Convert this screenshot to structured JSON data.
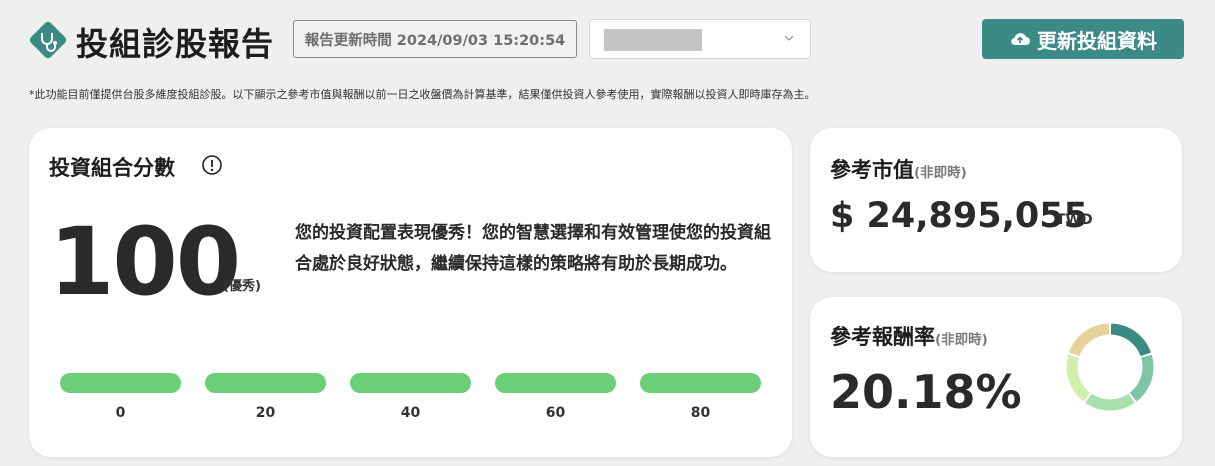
{
  "header": {
    "title": "投組診股報告",
    "update_time": "報告更新時間 2024/09/03 15:20:54",
    "update_button": "更新投組資料"
  },
  "disclaimer": "*此功能目前僅提供台股多維度投組診股。以下顯示之參考市值與報酬以前一日之收盤價為計算基準，結果僅供投資人參考使用，實際報酬以投資人即時庫存為主。",
  "score": {
    "title": "投資組合分數",
    "value": "100",
    "grade": "(優秀)",
    "description": "您的投資配置表現優秀！您的智慧選擇和有效管理使您的投資組合處於良好狀態，繼續保持這樣的策略將有助於長期成功。",
    "scale_ticks": [
      "0",
      "20",
      "40",
      "60",
      "80"
    ],
    "level_fraction": 1.0
  },
  "market_value": {
    "title": "參考市值",
    "qualifier": "(非即時)",
    "value": "$ 24,895,055",
    "unit": "TWD"
  },
  "return_rate": {
    "title": "參考報酬率",
    "qualifier": "(非即時)",
    "value": "20.18%",
    "donut_colors": [
      "#3c8a86",
      "#7fc4a4",
      "#a8e0ad",
      "#d2f0ab",
      "#e6d29a"
    ]
  },
  "colors": {
    "accent": "#3c8a86",
    "bar": "#6bcf77"
  }
}
